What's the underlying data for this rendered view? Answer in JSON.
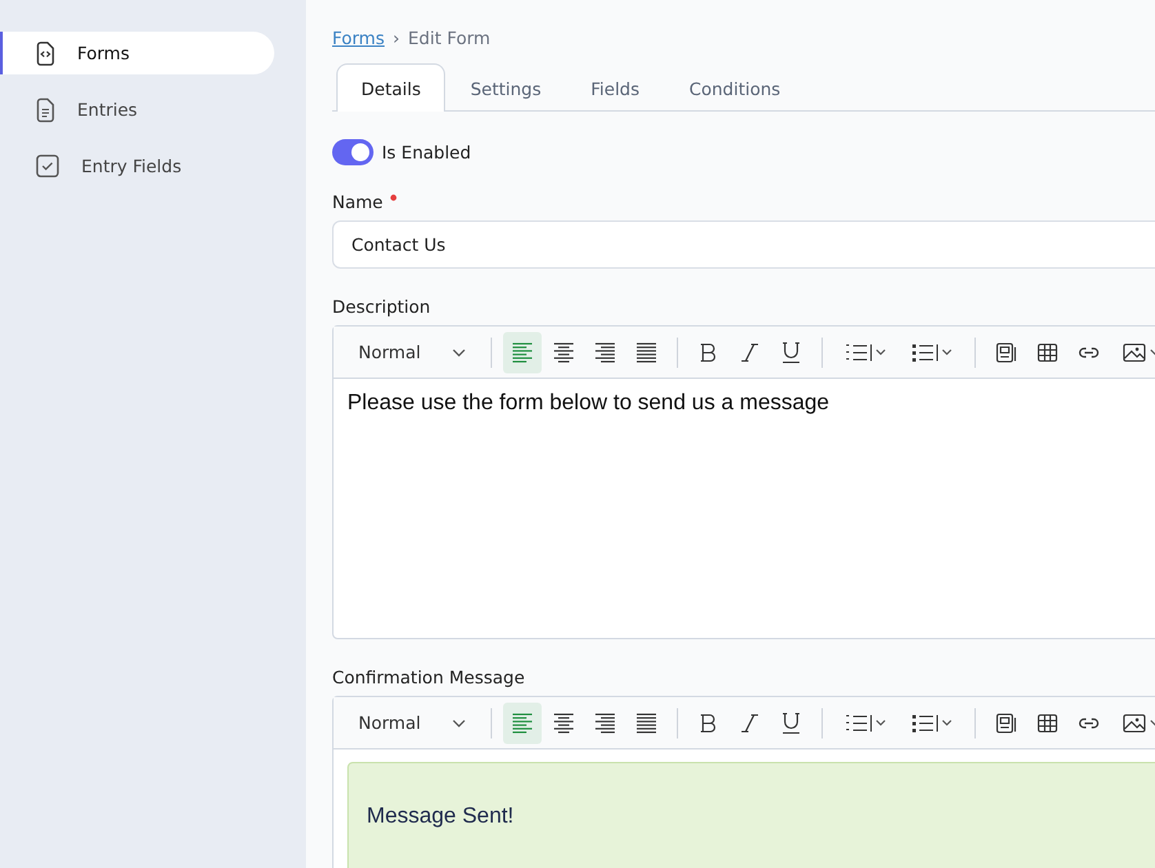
{
  "sidebar": {
    "items": [
      {
        "label": "Forms",
        "selected": true
      },
      {
        "label": "Entries",
        "selected": false
      },
      {
        "label": "Entry Fields",
        "selected": false
      }
    ]
  },
  "breadcrumb": {
    "link": "Forms",
    "separator": "›",
    "current": "Edit Form"
  },
  "tabs": [
    {
      "label": "Details",
      "selected": true
    },
    {
      "label": "Settings",
      "selected": false
    },
    {
      "label": "Fields",
      "selected": false
    },
    {
      "label": "Conditions",
      "selected": false
    }
  ],
  "enabled_toggle": {
    "label": "Is Enabled",
    "on": true
  },
  "name_field": {
    "label": "Name",
    "required": true,
    "value": "Contact Us"
  },
  "editors": [
    {
      "label": "Description",
      "format": "Normal",
      "alignments": [
        {
          "selected": true
        },
        {
          "selected": false
        },
        {
          "selected": false
        },
        {
          "selected": false
        }
      ],
      "content": "Please use the form below to send us a message"
    },
    {
      "label": "Confirmation Message",
      "format": "Normal",
      "alignments": [
        {
          "selected": true
        },
        {
          "selected": false
        },
        {
          "selected": false
        },
        {
          "selected": false
        }
      ],
      "content": "Message Sent!"
    }
  ]
}
